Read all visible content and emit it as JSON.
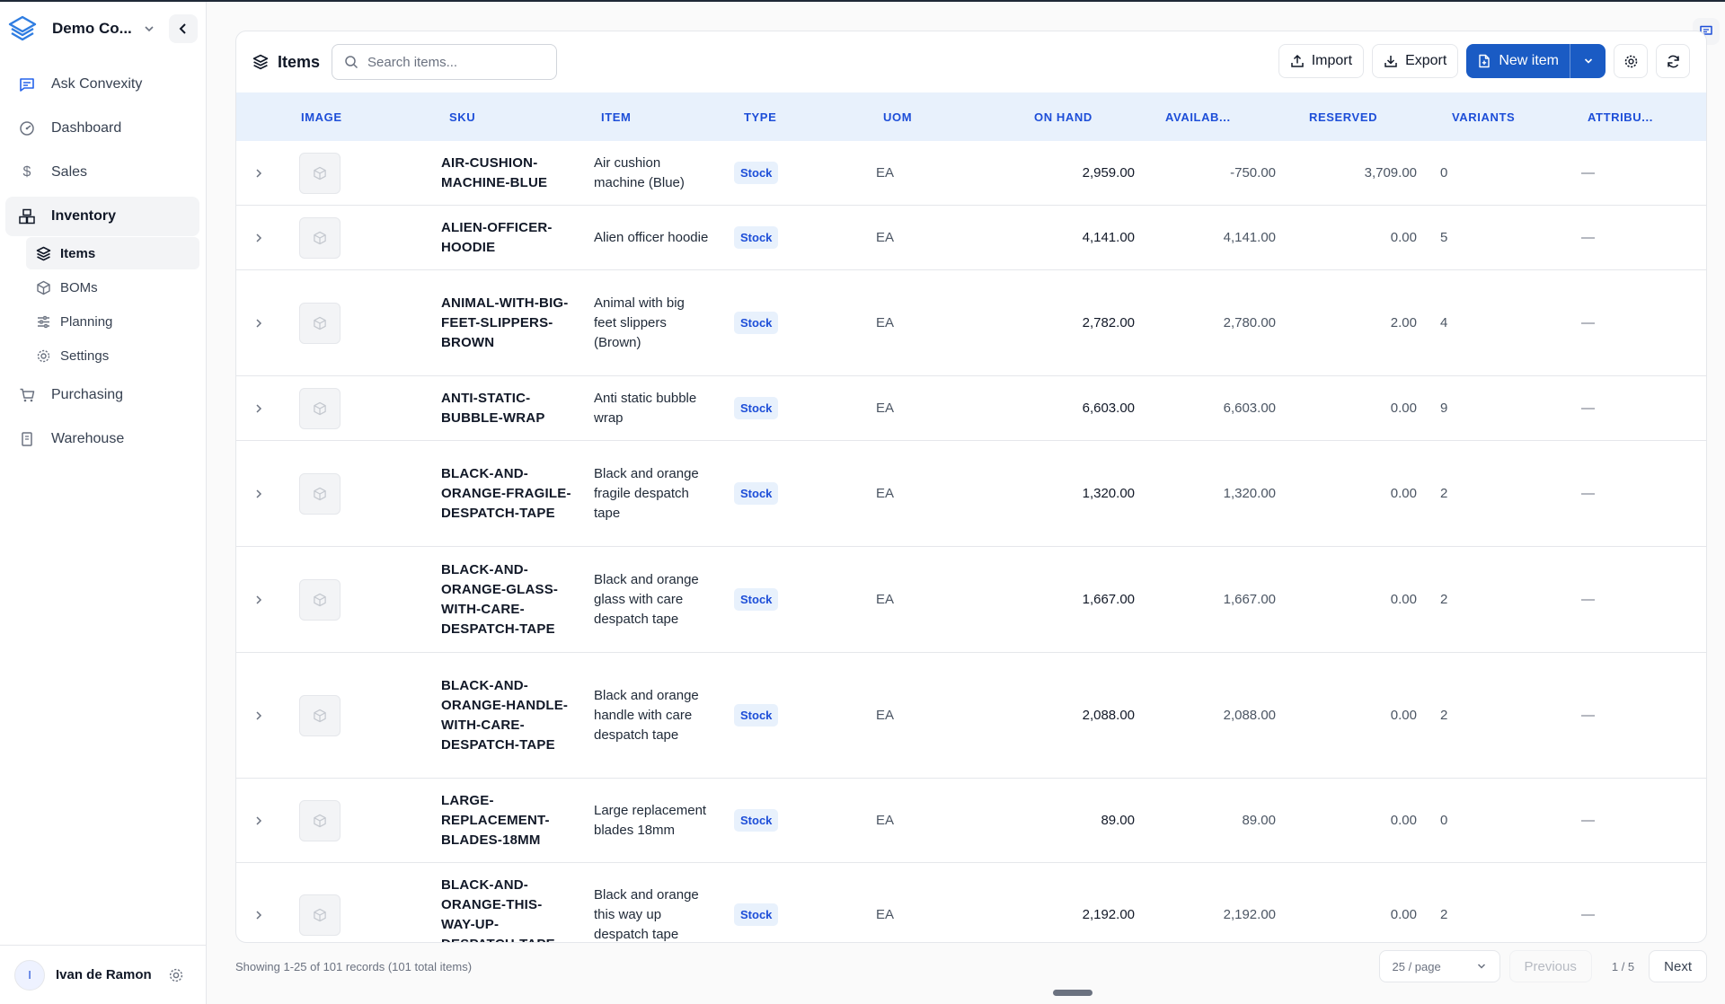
{
  "workspace": {
    "name": "Demo Co..."
  },
  "sidebar": {
    "items": [
      {
        "label": "Ask Convexity",
        "icon": "chat-icon"
      },
      {
        "label": "Dashboard",
        "icon": "dashboard-icon"
      },
      {
        "label": "Sales",
        "icon": "dollar-icon"
      },
      {
        "label": "Inventory",
        "icon": "boxes-icon"
      },
      {
        "label": "Purchasing",
        "icon": "cart-icon"
      },
      {
        "label": "Warehouse",
        "icon": "warehouse-icon"
      }
    ],
    "inventory_sub": [
      {
        "label": "Items",
        "icon": "layers-icon"
      },
      {
        "label": "BOMs",
        "icon": "package-icon"
      },
      {
        "label": "Planning",
        "icon": "sliders-icon"
      },
      {
        "label": "Settings",
        "icon": "gear-icon"
      }
    ]
  },
  "user": {
    "initial": "I",
    "name": "Ivan de Ramon"
  },
  "toolbar": {
    "title": "Items",
    "search_placeholder": "Search items...",
    "import_label": "Import",
    "export_label": "Export",
    "new_item_label": "New item"
  },
  "table": {
    "columns": [
      "IMAGE",
      "SKU",
      "ITEM",
      "TYPE",
      "UOM",
      "ON HAND",
      "AVAILAB...",
      "RESERVED",
      "VARIANTS",
      "ATTRIBU..."
    ],
    "rows": [
      {
        "sku": "AIR-CUSHION-MACHINE-BLUE",
        "item": "Air cushion machine (Blue)",
        "type": "Stock",
        "uom": "EA",
        "on_hand": "2,959.00",
        "available": "-750.00",
        "reserved": "3,709.00",
        "variants": "0",
        "attributes": "—"
      },
      {
        "sku": "ALIEN-OFFICER-HOODIE",
        "item": "Alien officer hoodie",
        "type": "Stock",
        "uom": "EA",
        "on_hand": "4,141.00",
        "available": "4,141.00",
        "reserved": "0.00",
        "variants": "5",
        "attributes": "—"
      },
      {
        "sku": "ANIMAL-WITH-BIG-FEET-SLIPPERS-BROWN",
        "item": "Animal with big feet slippers (Brown)",
        "type": "Stock",
        "uom": "EA",
        "on_hand": "2,782.00",
        "available": "2,780.00",
        "reserved": "2.00",
        "variants": "4",
        "attributes": "—"
      },
      {
        "sku": "ANTI-STATIC-BUBBLE-WRAP",
        "item": "Anti static bubble wrap",
        "type": "Stock",
        "uom": "EA",
        "on_hand": "6,603.00",
        "available": "6,603.00",
        "reserved": "0.00",
        "variants": "9",
        "attributes": "—"
      },
      {
        "sku": "BLACK-AND-ORANGE-FRAGILE-DESPATCH-TAPE",
        "item": "Black and orange fragile despatch tape",
        "type": "Stock",
        "uom": "EA",
        "on_hand": "1,320.00",
        "available": "1,320.00",
        "reserved": "0.00",
        "variants": "2",
        "attributes": "—"
      },
      {
        "sku": "BLACK-AND-ORANGE-GLASS-WITH-CARE-DESPATCH-TAPE",
        "item": "Black and orange glass with care despatch tape",
        "type": "Stock",
        "uom": "EA",
        "on_hand": "1,667.00",
        "available": "1,667.00",
        "reserved": "0.00",
        "variants": "2",
        "attributes": "—"
      },
      {
        "sku": "BLACK-AND-ORANGE-HANDLE-WITH-CARE-DESPATCH-TAPE",
        "item": "Black and orange handle with care despatch tape",
        "type": "Stock",
        "uom": "EA",
        "on_hand": "2,088.00",
        "available": "2,088.00",
        "reserved": "0.00",
        "variants": "2",
        "attributes": "—"
      },
      {
        "sku": "LARGE-REPLACEMENT-BLADES-18MM",
        "item": "Large replacement blades 18mm",
        "type": "Stock",
        "uom": "EA",
        "on_hand": "89.00",
        "available": "89.00",
        "reserved": "0.00",
        "variants": "0",
        "attributes": "—"
      },
      {
        "sku": "BLACK-AND-ORANGE-THIS-WAY-UP-DESPATCH-TAPE",
        "item": "Black and orange this way up despatch tape",
        "type": "Stock",
        "uom": "EA",
        "on_hand": "2,192.00",
        "available": "2,192.00",
        "reserved": "0.00",
        "variants": "2",
        "attributes": "—"
      }
    ]
  },
  "footer": {
    "records_text": "Showing 1-25 of 101 records (101 total items)",
    "page_size": "25 / page",
    "previous_label": "Previous",
    "page_info": "1 / 5",
    "next_label": "Next"
  },
  "colors": {
    "accent": "#1a5bc4",
    "header_bg": "#e8f1fc",
    "header_text": "#1d4ed8"
  }
}
